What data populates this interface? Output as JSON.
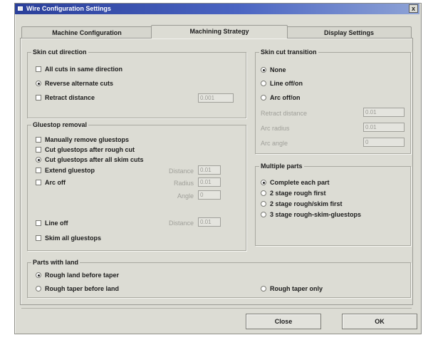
{
  "window": {
    "title": "Wire Configuration Settings",
    "close_label": "x"
  },
  "tabs": [
    {
      "label": "Machine Configuration"
    },
    {
      "label": "Machining Strategy"
    },
    {
      "label": "Display Settings"
    }
  ],
  "active_tab": "Machining Strategy",
  "skin_cut_direction": {
    "title": "Skin cut direction",
    "options": [
      {
        "label": "All cuts in same direction",
        "type": "checkbox",
        "checked": false
      },
      {
        "label": "Reverse alternate cuts",
        "type": "radio",
        "checked": true
      },
      {
        "label": "Retract distance",
        "type": "checkbox",
        "checked": false
      }
    ],
    "retract_distance_value": "0.001"
  },
  "gluestop_removal": {
    "title": "Gluestop removal",
    "options": [
      {
        "label": "Manually remove gluestops",
        "checked": false
      },
      {
        "label": "Cut gluestops after rough cut",
        "checked": false
      },
      {
        "label": "Cut gluestops after all skim cuts",
        "checked": true
      },
      {
        "label": "Extend gluestop",
        "checked": false
      },
      {
        "label": "Arc off",
        "checked": false
      },
      {
        "label": "Line off",
        "checked": false
      },
      {
        "label": "Skim all gluestops",
        "checked": false
      }
    ],
    "fields": {
      "distance_label": "Distance",
      "distance_value": "0.01",
      "radius_label": "Radius",
      "radius_value": "0.01",
      "angle_label": "Angle",
      "angle_value": "0",
      "line_distance_label": "Distance",
      "line_distance_value": "0.01"
    }
  },
  "skin_cut_transition": {
    "title": "Skin cut transition",
    "options": [
      {
        "label": "None",
        "checked": true
      },
      {
        "label": "Line off/on",
        "checked": false
      },
      {
        "label": "Arc off/on",
        "checked": false
      }
    ],
    "fields": [
      {
        "label": "Retract distance",
        "value": "0.01"
      },
      {
        "label": "Arc radius",
        "value": "0.01"
      },
      {
        "label": "Arc angle",
        "value": "0"
      }
    ]
  },
  "multiple_parts": {
    "title": "Multiple parts",
    "options": [
      {
        "label": "Complete each part",
        "checked": true
      },
      {
        "label": "2 stage rough first",
        "checked": false
      },
      {
        "label": "2 stage rough/skim first",
        "checked": false
      },
      {
        "label": "3 stage rough-skim-gluestops",
        "checked": false
      }
    ]
  },
  "parts_with_land": {
    "title": "Parts with land",
    "options": [
      {
        "label": "Rough land before taper",
        "checked": true
      },
      {
        "label": "Rough taper before land",
        "checked": false
      },
      {
        "label": "Rough taper only",
        "checked": false
      }
    ]
  },
  "buttons": {
    "close_label": "Close",
    "ok_label": "OK"
  },
  "colors": {
    "title_bar_start": "#2a3f9a",
    "title_bar_end": "#8ea3d6",
    "dialog_face": "#dcdcd4"
  }
}
